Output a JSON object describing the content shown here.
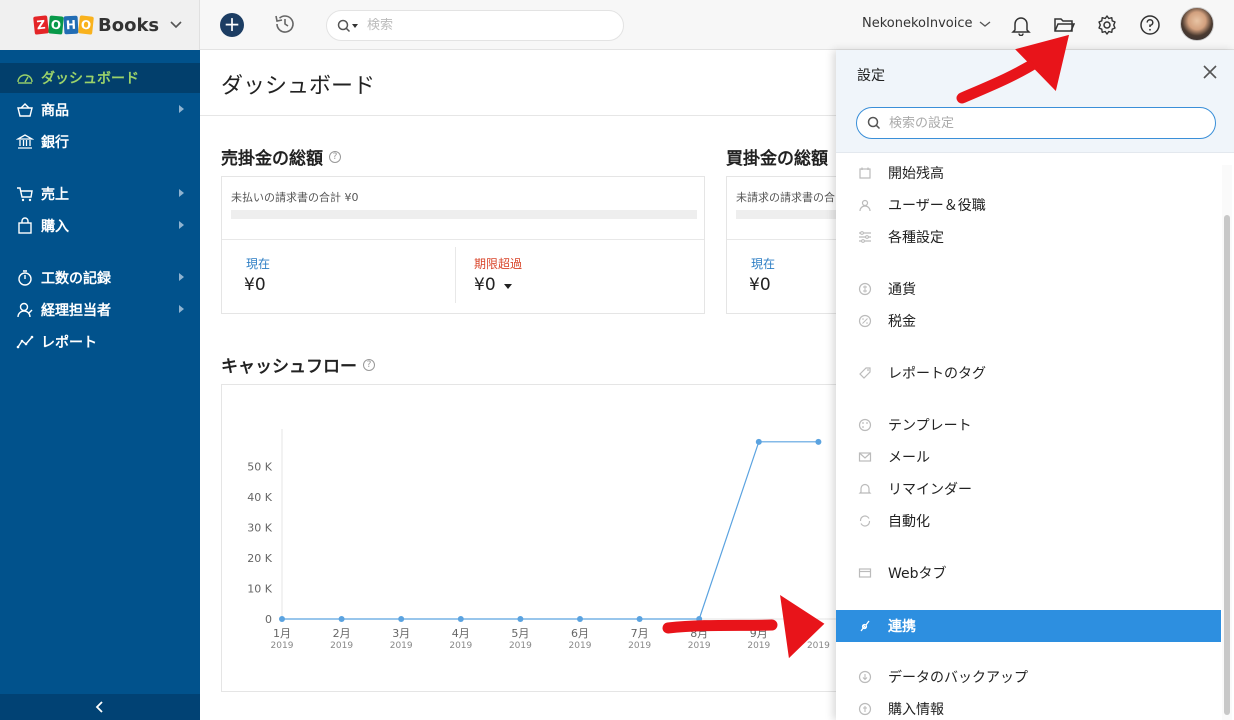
{
  "brand": {
    "logo_letters": [
      "Z",
      "O",
      "H",
      "O"
    ],
    "logo_colors": [
      "#e42527",
      "#089949",
      "#226db4",
      "#f9b21d"
    ],
    "product": "Books"
  },
  "topbar": {
    "search_placeholder": "検索",
    "org_name": "NekonekoInvoice",
    "icons": [
      "plus-icon",
      "history-icon",
      "search-icon",
      "bell-icon",
      "folder-icon",
      "gear-icon",
      "help-icon"
    ]
  },
  "sidebar": {
    "items": [
      {
        "label": "ダッシュボード",
        "icon": "dashboard-icon",
        "active": true,
        "has_arrow": false
      },
      {
        "label": "商品",
        "icon": "basket-icon",
        "active": false,
        "has_arrow": true
      },
      {
        "label": "銀行",
        "icon": "bank-icon",
        "active": false,
        "has_arrow": false
      },
      {
        "label": "売上",
        "icon": "cart-icon",
        "active": false,
        "has_arrow": true
      },
      {
        "label": "購入",
        "icon": "bag-icon",
        "active": false,
        "has_arrow": true
      },
      {
        "label": "工数の記録",
        "icon": "stopwatch-icon",
        "active": false,
        "has_arrow": true
      },
      {
        "label": "経理担当者",
        "icon": "accountant-icon",
        "active": false,
        "has_arrow": true
      },
      {
        "label": "レポート",
        "icon": "report-icon",
        "active": false,
        "has_arrow": false
      }
    ]
  },
  "main": {
    "title": "ダッシュボード",
    "receivables": {
      "title": "売掛金の総額",
      "caption": "未払いの請求書の合計 ¥0",
      "current_label": "現在",
      "current_value": "¥0",
      "overdue_label": "期限超過",
      "overdue_value": "¥0"
    },
    "payables": {
      "title": "買掛金の総額",
      "caption": "未請求の請求書の合",
      "current_label": "現在",
      "current_value": "¥0"
    },
    "cashflow": {
      "title": "キャッシュフロー"
    }
  },
  "chart_data": {
    "type": "line",
    "title": "キャッシュフロー",
    "categories": [
      "1月 2019",
      "2月 2019",
      "3月 2019",
      "4月 2019",
      "5月 2019",
      "6月 2019",
      "7月 2019",
      "8月 2019",
      "9月 2019",
      "10月 2019"
    ],
    "category_labels": [
      [
        "1月",
        "2019"
      ],
      [
        "2月",
        "2019"
      ],
      [
        "3月",
        "2019"
      ],
      [
        "4月",
        "2019"
      ],
      [
        "5月",
        "2019"
      ],
      [
        "6月",
        "2019"
      ],
      [
        "7月",
        "2019"
      ],
      [
        "8月",
        "2019"
      ],
      [
        "9月",
        "2019"
      ],
      [
        "",
        "2019"
      ]
    ],
    "values": [
      0,
      0,
      0,
      0,
      0,
      0,
      0,
      0,
      58000,
      58000
    ],
    "ylim": [
      0,
      55000
    ],
    "yticks": [
      0,
      10000,
      20000,
      30000,
      40000,
      50000
    ],
    "ytick_labels": [
      "0",
      "10 K",
      "20 K",
      "30 K",
      "40 K",
      "50 K"
    ],
    "line_color": "#5ba3e0",
    "grid": false
  },
  "settings": {
    "title": "設定",
    "search_placeholder": "検索の設定",
    "items": [
      {
        "label": "開始残高",
        "icon": "calendar-icon",
        "active": false
      },
      {
        "label": "ユーザー＆役職",
        "icon": "users-icon",
        "active": false
      },
      {
        "label": "各種設定",
        "icon": "sliders-icon",
        "active": false
      },
      {
        "label": "通貨",
        "icon": "currency-icon",
        "active": false
      },
      {
        "label": "税金",
        "icon": "percent-icon",
        "active": false
      },
      {
        "label": "レポートのタグ",
        "icon": "tag-icon",
        "active": false
      },
      {
        "label": "テンプレート",
        "icon": "palette-icon",
        "active": false
      },
      {
        "label": "メール",
        "icon": "mail-icon",
        "active": false
      },
      {
        "label": "リマインダー",
        "icon": "bell-icon",
        "active": false
      },
      {
        "label": "自動化",
        "icon": "refresh-icon",
        "active": false
      },
      {
        "label": "Webタブ",
        "icon": "window-icon",
        "active": false
      },
      {
        "label": "連携",
        "icon": "integration-icon",
        "active": true
      },
      {
        "label": "データのバックアップ",
        "icon": "backup-icon",
        "active": false
      },
      {
        "label": "購入情報",
        "icon": "subscription-icon",
        "active": false
      }
    ]
  },
  "annotations": {
    "arrow_color": "#e8141a"
  }
}
